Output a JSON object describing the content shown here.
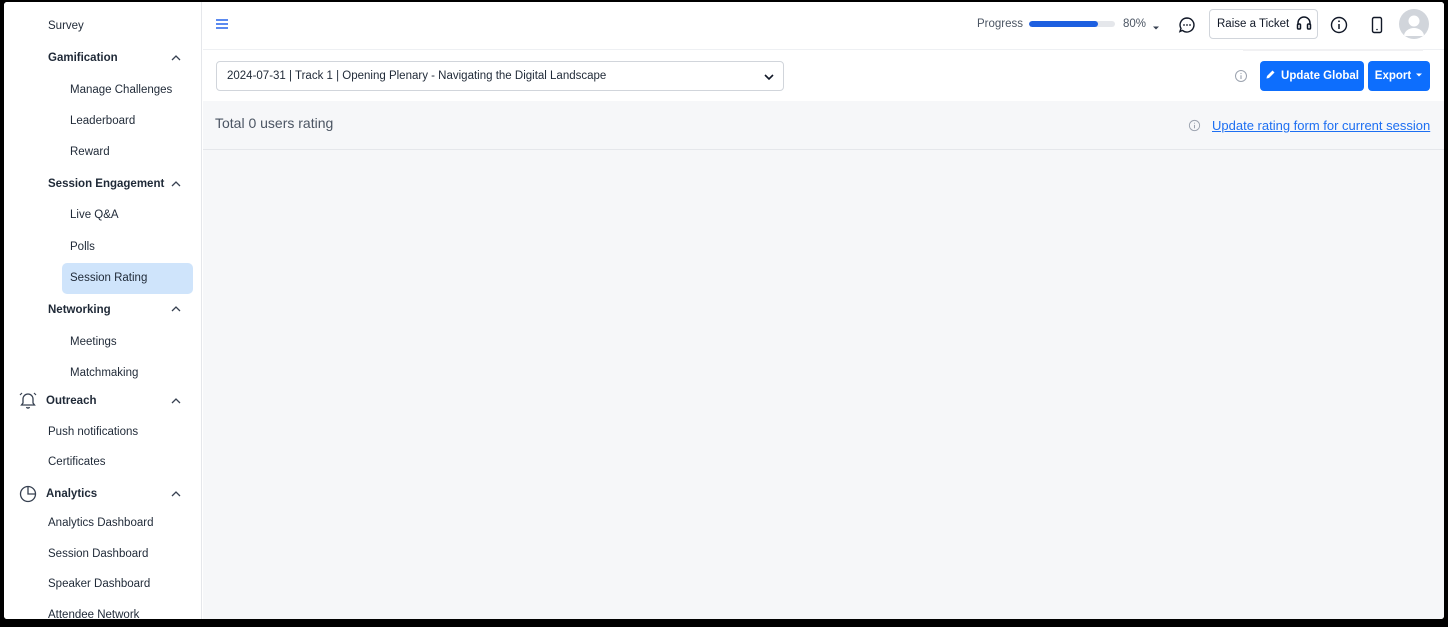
{
  "sidebar": {
    "items": [
      {
        "label": "Survey"
      },
      {
        "label": "Gamification"
      },
      {
        "label": "Manage Challenges"
      },
      {
        "label": "Leaderboard"
      },
      {
        "label": "Reward"
      },
      {
        "label": "Session Engagement"
      },
      {
        "label": "Live Q&A"
      },
      {
        "label": "Polls"
      },
      {
        "label": "Session Rating"
      },
      {
        "label": "Networking"
      },
      {
        "label": "Meetings"
      },
      {
        "label": "Matchmaking"
      },
      {
        "label": "Outreach"
      },
      {
        "label": "Push notifications"
      },
      {
        "label": "Certificates"
      },
      {
        "label": "Analytics"
      },
      {
        "label": "Analytics Dashboard"
      },
      {
        "label": "Session Dashboard"
      },
      {
        "label": "Speaker Dashboard"
      },
      {
        "label": "Attendee Network"
      }
    ],
    "active": "Session Rating",
    "icons": {
      "outreach": "bell-icon",
      "analytics": "pie-chart-icon"
    }
  },
  "topbar": {
    "menu_icon": "hamburger-icon",
    "progress_label": "Progress",
    "progress_value": 0.8,
    "progress_text": "80%",
    "raise_ticket_label": "Raise a Ticket",
    "icons": [
      "chat-icon",
      "headset-icon",
      "info-icon",
      "phone-icon",
      "avatar-icon"
    ]
  },
  "filter": {
    "session_selected": "2024-07-31 | Track 1 | Opening Plenary - Navigating the Digital Landscape",
    "update_global_label": "Update Global",
    "export_label": "Export"
  },
  "rating": {
    "total_text": "Total 0 users rating",
    "update_form_link": "Update rating form for current session"
  },
  "colors": {
    "accent": "#0d6efd",
    "active_bg": "#cfe4fb",
    "link": "#1d6ff2",
    "progress": "#1d5fe0"
  }
}
